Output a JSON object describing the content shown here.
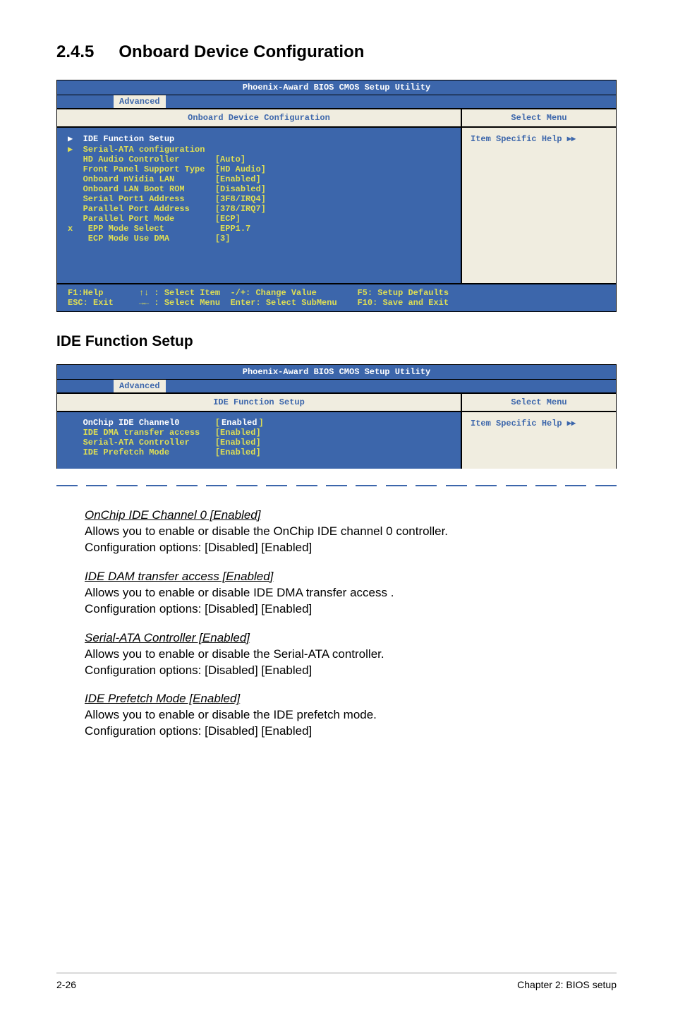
{
  "section": {
    "number": "2.4.5",
    "title": "Onboard Device Configuration"
  },
  "bios1": {
    "header": "Phoenix-Award BIOS CMOS Setup Utility",
    "tab": "Advanced",
    "title_left": "Onboard Device Configuration",
    "title_right": "Select Menu",
    "rows": [
      {
        "label": "IDE Function Setup",
        "value": ""
      },
      {
        "label": "Serial-ATA configuration",
        "value": ""
      },
      {
        "label": "HD Audio Controller",
        "value": "[Auto]"
      },
      {
        "label": "Front Panel Support Type",
        "value": "[HD Audio]"
      },
      {
        "label": "Onboard nVidia LAN",
        "value": "[Enabled]"
      },
      {
        "label": "Onboard LAN Boot ROM",
        "value": "[Disabled]"
      },
      {
        "label": "Serial Port1 Address",
        "value": "[3F8/IRQ4]"
      },
      {
        "label": "Parallel Port Address",
        "value": "[378/IRQ7]"
      },
      {
        "label": "Parallel Port Mode",
        "value": "[ECP]"
      },
      {
        "label": " EPP Mode Select",
        "value": " EPP1.7",
        "prefix": "x"
      },
      {
        "label": " ECP Mode Use DMA",
        "value": "[3]"
      }
    ],
    "help": "Item Specific Help",
    "footer": {
      "f1": "F1:Help",
      "sel_item": "Select Item",
      "chg": "-/+: Change Value",
      "f5": "F5: Setup Defaults",
      "esc": "ESC: Exit",
      "sel_menu": "Select Menu",
      "enter": "Enter: Select SubMenu",
      "f10": "F10: Save and Exit"
    }
  },
  "subsection": "IDE Function Setup",
  "bios2": {
    "header": "Phoenix-Award BIOS CMOS Setup Utility",
    "tab": "Advanced",
    "title_left": "IDE Function Setup",
    "title_right": "Select Menu",
    "rows": [
      {
        "label": "OnChip IDE Channel0",
        "value": "Enabled",
        "highlight": true,
        "white": true
      },
      {
        "label": "IDE DMA transfer access",
        "value": "[Enabled]"
      },
      {
        "label": "Serial-ATA Controller",
        "value": "[Enabled]"
      },
      {
        "label": "IDE Prefetch Mode",
        "value": "[Enabled]"
      }
    ],
    "help": "Item Specific Help"
  },
  "items": [
    {
      "title": "OnChip IDE Channel 0 [Enabled]",
      "desc": "Allows you to enable or disable the OnChip IDE channel 0 controller.",
      "opts": "Configuration options: [Disabled] [Enabled]"
    },
    {
      "title": "IDE DAM transfer access [Enabled]",
      "desc": "Allows you to enable or disable IDE DMA transfer access .",
      "opts": "Configuration options: [Disabled] [Enabled]"
    },
    {
      "title": "Serial-ATA Controller [Enabled]",
      "desc": "Allows you to enable or disable the Serial-ATA controller.",
      "opts": "Configuration options: [Disabled] [Enabled]"
    },
    {
      "title": "IDE Prefetch Mode [Enabled]",
      "desc": "Allows you to enable or disable the IDE prefetch mode.",
      "opts": "Configuration options: [Disabled] [Enabled]"
    }
  ],
  "footer": {
    "left": "2-26",
    "right": "Chapter 2: BIOS setup"
  }
}
